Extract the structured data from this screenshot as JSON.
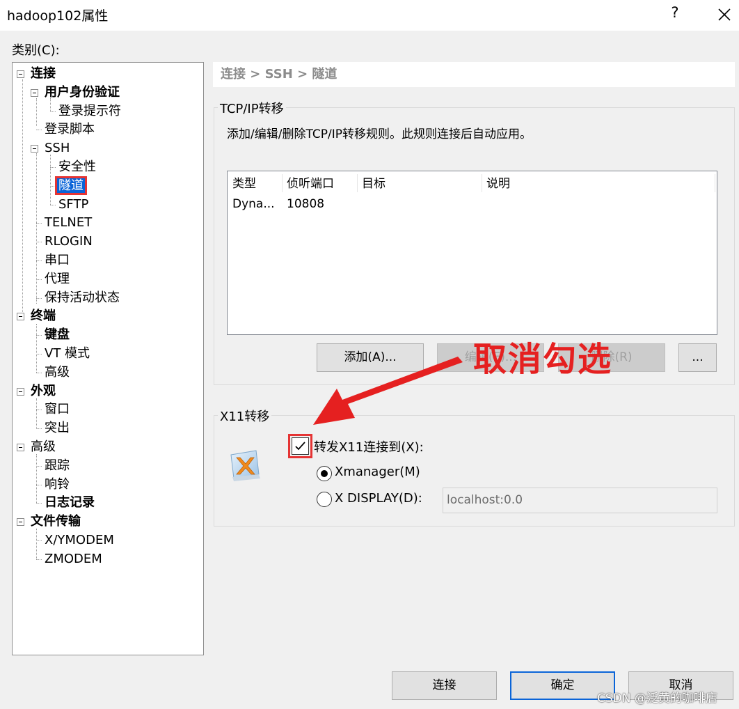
{
  "window": {
    "title": "hadoop102属性",
    "help_label": "?"
  },
  "category_label": "类别(C):",
  "tree": [
    {
      "label": "连接",
      "bold": true
    },
    {
      "label": "用户身份验证",
      "bold": true
    },
    {
      "label": "登录提示符",
      "bold": false
    },
    {
      "label": "登录脚本",
      "bold": false
    },
    {
      "label": "SSH",
      "bold": false
    },
    {
      "label": "安全性",
      "bold": false
    },
    {
      "label": "隧道",
      "bold": false,
      "selected": true
    },
    {
      "label": "SFTP",
      "bold": false
    },
    {
      "label": "TELNET",
      "bold": false
    },
    {
      "label": "RLOGIN",
      "bold": false
    },
    {
      "label": "串口",
      "bold": false
    },
    {
      "label": "代理",
      "bold": false
    },
    {
      "label": "保持活动状态",
      "bold": false
    },
    {
      "label": "终端",
      "bold": true
    },
    {
      "label": "键盘",
      "bold": true
    },
    {
      "label": "VT 模式",
      "bold": false
    },
    {
      "label": "高级",
      "bold": false
    },
    {
      "label": "外观",
      "bold": true
    },
    {
      "label": "窗口",
      "bold": false
    },
    {
      "label": "突出",
      "bold": false
    },
    {
      "label": "高级",
      "bold": false
    },
    {
      "label": "跟踪",
      "bold": false
    },
    {
      "label": "响铃",
      "bold": false
    },
    {
      "label": "日志记录",
      "bold": true
    },
    {
      "label": "文件传输",
      "bold": true
    },
    {
      "label": "X/YMODEM",
      "bold": false
    },
    {
      "label": "ZMODEM",
      "bold": false
    }
  ],
  "breadcrumb": "连接 > SSH > 隧道",
  "tcp_group": {
    "title": "TCP/IP转移",
    "description": "添加/编辑/删除TCP/IP转移规则。此规则连接后自动应用。",
    "columns": [
      "类型",
      "侦听端口",
      "目标",
      "说明"
    ],
    "rows": [
      [
        "Dyna...",
        "10808",
        "",
        ""
      ]
    ],
    "buttons": {
      "add": "添加(A)...",
      "edit": "编辑(E)...",
      "delete": "删除(R)",
      "more": "..."
    }
  },
  "x11_group": {
    "title": "X11转移",
    "forward_label": "转发X11连接到(X):",
    "forward_checked": true,
    "xmanager_label": "Xmanager(M)",
    "xdisplay_label": "X DISPLAY(D):",
    "selected_option": "Xmanager(M)",
    "xdisplay_value": "localhost:0.0"
  },
  "annotation": "取消勾选",
  "footer": {
    "connect": "连接",
    "ok": "确定",
    "cancel": "取消"
  },
  "watermark": "CSDN @泛黄的咖啡店",
  "colors": {
    "selection": "#0a64d8",
    "annotation_red": "#e52020"
  }
}
